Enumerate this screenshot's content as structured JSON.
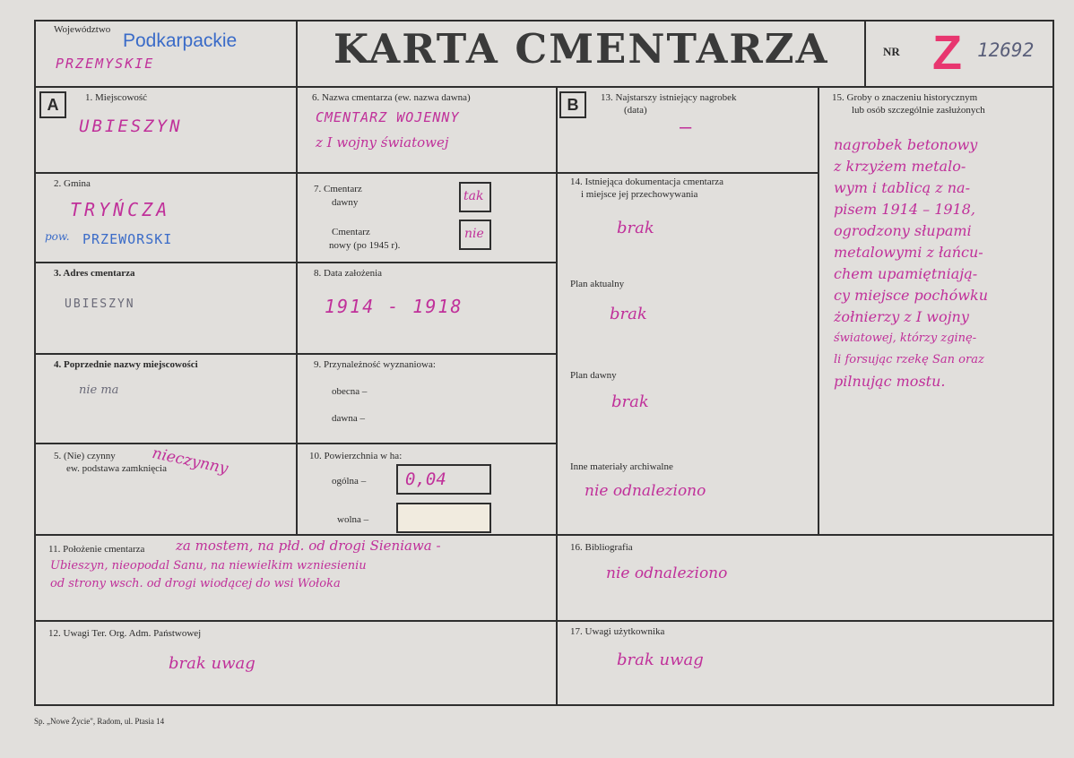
{
  "header": {
    "wojewodztwo_label": "Województwo",
    "wojewodztwo_stamp": "Podkarpackie",
    "wojewodztwo_hw": "PRZEMYSKIE",
    "title": "KARTA CMENTARZA",
    "nr_label": "NR",
    "nr_letter": "Z",
    "nr_value": "12692"
  },
  "left": {
    "section_a": "A",
    "f1_label": "1. Miejscowość",
    "f1_value": "UBIESZYN",
    "f2_label": "2. Gmina",
    "f2_value": "TRYŃCZA",
    "f2_pow": "pow.",
    "f2_stamp": "PRZEWORSKI",
    "f3_label": "3. Adres cmentarza",
    "f3_value": "UBIESZYN",
    "f4_label": "4. Poprzednie nazwy miejscowości",
    "f4_value": "nie ma",
    "f5_label_1": "5. (Nie) czynny",
    "f5_label_2": "ew. podstawa zamknięcia",
    "f5_value": "nieczynny"
  },
  "middle": {
    "f6_label": "6. Nazwa cmentarza (ew. nazwa dawna)",
    "f6_value_1": "CMENTARZ WOJENNY",
    "f6_value_2": "z I wojny światowej",
    "f7_label": "7. Cmentarz",
    "f7_dawny": "dawny",
    "f7_dawny_val": "tak",
    "f7_nowy_1": "Cmentarz",
    "f7_nowy_2": "nowy (po 1945 r).",
    "f7_nowy_val": "nie",
    "f8_label": "8. Data założenia",
    "f8_value": "1914 - 1918",
    "f9_label": "9. Przynależność wyznaniowa:",
    "f9_obecna": "obecna –",
    "f9_dawna": "dawna –",
    "f10_label": "10. Powierzchnia w ha:",
    "f10_ogolna": "ogólna –",
    "f10_ogolna_val": "0,04",
    "f10_wolna": "wolna –"
  },
  "right": {
    "section_b": "B",
    "f13_label_1": "13. Najstarszy istniejący nagrobek",
    "f13_label_2": "(data)",
    "f13_value": "–",
    "f14_label_1": "14. Istniejąca dokumentacja cmentarza",
    "f14_label_2": "i miejsce jej przechowywania",
    "f14_value": "brak",
    "plan_akt_label": "Plan aktualny",
    "plan_akt_value": "brak",
    "plan_daw_label": "Plan dawny",
    "plan_daw_value": "brak",
    "inne_label": "Inne materiały archiwalne",
    "inne_value": "nie odnaleziono",
    "f15_label_1": "15. Groby o znaczeniu historycznym",
    "f15_label_2": "lub osób szczególnie zasłużonych",
    "f15_lines": [
      "nagrobek betonowy",
      "z krzyżem metalo-",
      "wym i tablicą z na-",
      "pisem 1914 – 1918,",
      "ogrodzony słupami",
      "metalowymi z łańcu-",
      "chem upamiętniają-",
      "cy miejsce pochówku",
      "żołnierzy z I wojny",
      "światowej, którzy zginę-",
      "li forsując rzekę San oraz",
      "pilnując mostu."
    ]
  },
  "bottom": {
    "f11_label": "11. Położenie cmentarza",
    "f11_line_1": "za mostem, na płd. od drogi Sieniawa -",
    "f11_line_2": "Ubieszyn, nieopodal Sanu, na niewielkim wzniesieniu",
    "f11_line_3": "od strony wsch. od drogi wiodącej do wsi Wołoka",
    "f16_label": "16. Bibliografia",
    "f16_value": "nie odnaleziono",
    "f12_label": "12. Uwagi Ter. Org. Adm. Państwowej",
    "f12_value": "brak uwag",
    "f17_label": "17. Uwagi użytkownika",
    "f17_value": "brak uwag",
    "footer": "Sp. „Nowe Życie\", Radom, ul. Ptasia 14"
  }
}
